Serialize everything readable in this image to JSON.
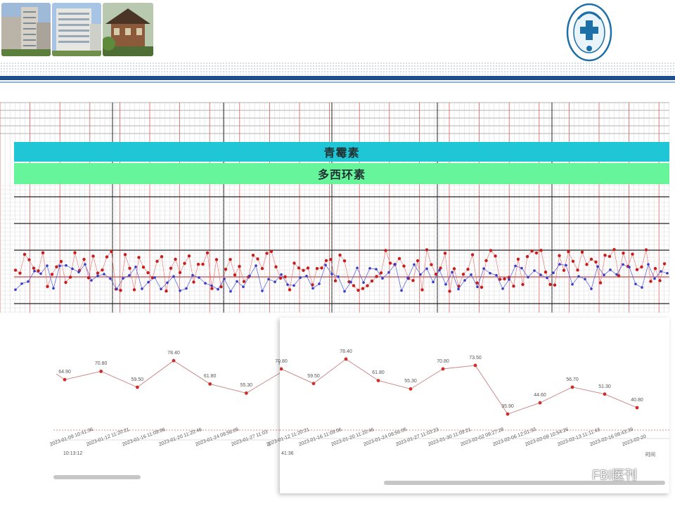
{
  "chart_top": {
    "drug_bars": [
      "青霉素",
      "多西环素"
    ]
  },
  "chart_data": [
    {
      "type": "line",
      "x": [
        "2023-01-09 10:13:12",
        "2023-01-12 11:20:21",
        "2023-01-16 11:09:06",
        "2023-01-20 11:20:46",
        "2023-01-24 09:56:05",
        "2023-01-27 11:03"
      ],
      "values": [
        64.9,
        70.8,
        59.5,
        78.4,
        61.8,
        55.3,
        70.8
      ],
      "value_labels": [
        "64.90",
        "70.80",
        "59.50",
        "78.40",
        "61.80",
        "55.30",
        "70.8"
      ],
      "x_labels": [
        "2023-01-09 10:41:36",
        "2023-01-12 11:20:21",
        "2023-01-16 11:09:06",
        "2023-01-20 11:20:46",
        "2023-01-24 09:56:05",
        "2023-01-27 11:03",
        "2"
      ],
      "x_label_tail": [
        "10:13:12"
      ]
    },
    {
      "type": "line",
      "values": [
        70.8,
        59.5,
        78.4,
        61.8,
        55.3,
        70.8,
        73.5,
        35.9,
        44.6,
        56.7,
        51.3,
        40.8
      ],
      "value_labels": [
        "70.80",
        "59.50",
        "78.40",
        "61.80",
        "55.30",
        "70.80",
        "73.50",
        "35.90",
        "44.60",
        "56.70",
        "51.30",
        "40.80"
      ],
      "x_labels": [
        "2023-01-12 11:20:21",
        "2023-01-16 11:09:06",
        "2023-01-20 11:20:46",
        "2023-01-24 09:56:05",
        "2023-01-27 11:03:23",
        "2023-01-30 11:09:21",
        "2023-02-02 09:27:28",
        "2023-02-06 12:01:33",
        "2023-02-09 10:54:26",
        "2023-02-13 11:11:43",
        "2023-02-16 09:43:39",
        "2023-02-20"
      ],
      "x_label_head": "41:36",
      "axis_tail": "时间",
      "first_label": "70.80"
    }
  ],
  "watermark": {
    "text": "FBI医刊"
  }
}
